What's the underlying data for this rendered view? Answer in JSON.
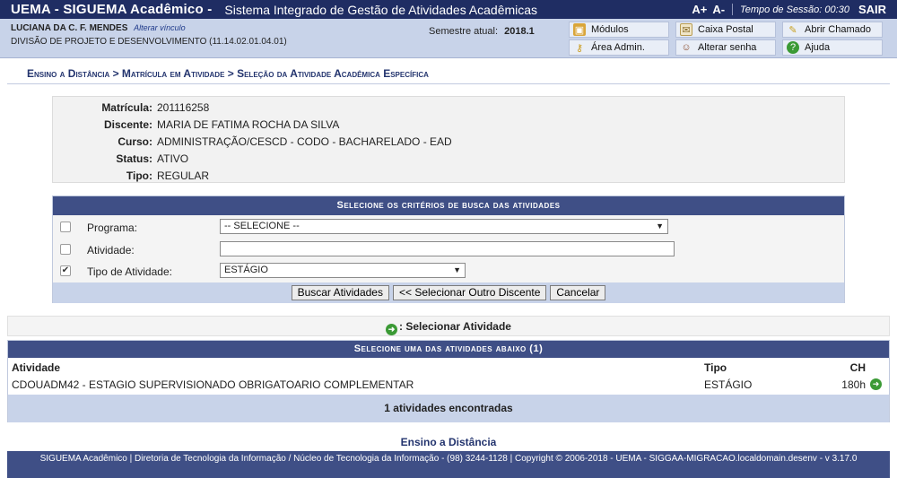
{
  "topbar": {
    "system_name": "UEMA - SIGUEMA Acadêmico -",
    "system_desc": "Sistema Integrado de Gestão de Atividades Acadêmicas",
    "font_increase": "A+",
    "font_decrease": "A-",
    "session_label": "Tempo de Sessão: 00:30",
    "exit_label": "SAIR"
  },
  "infobar": {
    "user_name": "LUCIANA DA C. F. MENDES",
    "change_link": "Alterar vínculo",
    "unit": "DIVISÃO DE PROJETO E DESENVOLVIMENTO (11.14.02.01.04.01)",
    "semester_label": "Semestre atual:",
    "semester_value": "2018.1",
    "menu": {
      "modulos": "Módulos",
      "caixa_postal": "Caixa Postal",
      "abrir_chamado": "Abrir Chamado",
      "area_admin": "Área Admin.",
      "alterar_senha": "Alterar senha",
      "ajuda": "Ajuda"
    },
    "colors": {
      "topbar": "#1f2d63",
      "infobar": "#c8d3e9",
      "header": "#3f4f86"
    }
  },
  "breadcrumb": "Ensino a Distância > Matrícula em Atividade > Seleção da Atividade Acadêmica Específica",
  "student": {
    "matricula_label": "Matrícula:",
    "matricula": "201116258",
    "discente_label": "Discente:",
    "discente": "MARIA DE FATIMA ROCHA DA SILVA",
    "curso_label": "Curso:",
    "curso": "ADMINISTRAÇÃO/CESCD - CODO - BACHARELADO - EAD",
    "status_label": "Status:",
    "status": "ATIVO",
    "tipo_label": "Tipo:",
    "tipo": "REGULAR"
  },
  "search": {
    "caption": "Selecione os critérios de busca das atividades",
    "programa_label": "Programa:",
    "programa_value": "-- SELECIONE --",
    "programa_checked": false,
    "atividade_label": "Atividade:",
    "atividade_value": "",
    "atividade_checked": false,
    "tipo_label": "Tipo de Atividade:",
    "tipo_value": "ESTÁGIO",
    "tipo_checked": true,
    "buscar": "Buscar Atividades",
    "outro": "<< Selecionar Outro Discente",
    "cancelar": "Cancelar"
  },
  "legend": ": Selecionar Atividade",
  "results": {
    "caption": "Selecione uma das atividades abaixo (1)",
    "headers": {
      "atividade": "Atividade",
      "tipo": "Tipo",
      "ch": "CH"
    },
    "rows": [
      {
        "atividade": "CDOUADM42 - ESTAGIO SUPERVISIONADO OBRIGATOARIO COMPLEMENTAR",
        "tipo": "ESTÁGIO",
        "ch": "180h"
      }
    ],
    "count": "1 atividades encontradas"
  },
  "footer": {
    "link": "Ensino a Distância",
    "text": "SIGUEMA Acadêmico | Diretoria de Tecnologia da Informação / Núcleo de Tecnologia da Informação - (98) 3244-1128 | Copyright © 2006-2018 - UEMA - SIGGAA-MIGRACAO.localdomain.desenv - v 3.17.0"
  }
}
